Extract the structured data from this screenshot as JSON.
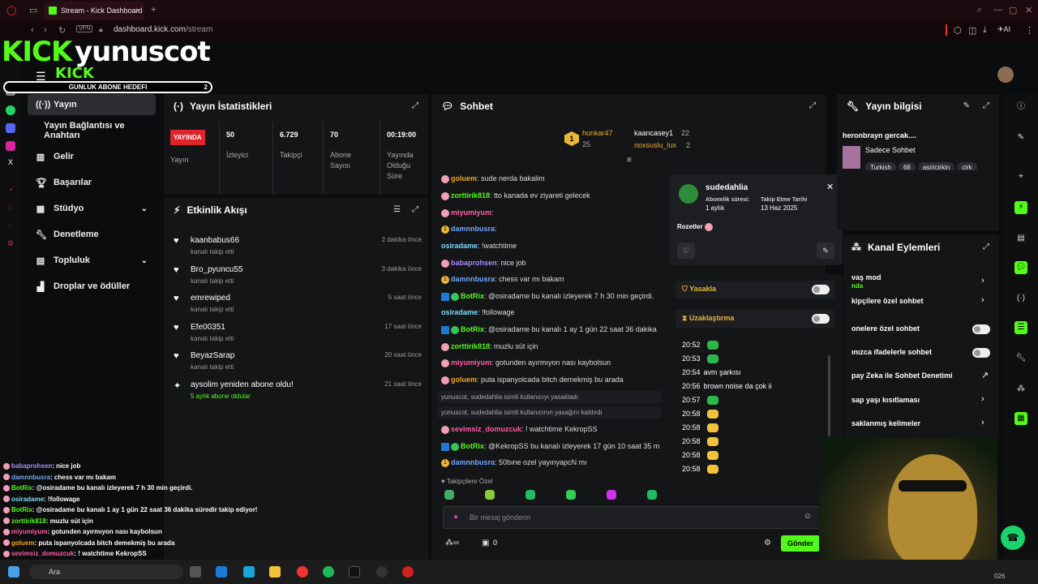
{
  "browser": {
    "tab_title": "Stream - Kick Dashboard",
    "url_domain": "dashboard.kick.com",
    "url_path": "/stream",
    "vpn": "VPN",
    "ai_label": "AI"
  },
  "overlay": {
    "logo_kick": "KICK",
    "channel_name": "yunuscot",
    "logo_small": "KICK",
    "sub_goal_label": "GUNLUK ABONE HEDEFI",
    "sub_goal_count": "2"
  },
  "sidebar": {
    "items": [
      {
        "label": "Yayın",
        "icon": "broadcast-icon"
      },
      {
        "label": "Yayın Bağlantısı ve Anahtarı",
        "icon": ""
      },
      {
        "label": "Gelir",
        "icon": "chart-icon"
      },
      {
        "label": "Başarılar",
        "icon": "trophy-icon"
      },
      {
        "label": "Stüdyo",
        "icon": "studio-icon"
      },
      {
        "label": "Denetleme",
        "icon": "wrench-icon"
      },
      {
        "label": "Topluluk",
        "icon": "community-icon"
      },
      {
        "label": "Droplar ve ödüller",
        "icon": "drops-icon"
      }
    ]
  },
  "stats": {
    "title": "Yayın İstatistikleri",
    "live_badge": "YAYINDA",
    "cells": [
      {
        "value": "",
        "label": "Yayın"
      },
      {
        "value": "50",
        "label": "İzleyici"
      },
      {
        "value": "6.729",
        "label": "Takipçi"
      },
      {
        "value": "70",
        "label": "Abone Sayısı"
      },
      {
        "value": "00:19:00",
        "label": "Yayında Olduğu Süre"
      }
    ]
  },
  "activity": {
    "title": "Etkinlik Akışı",
    "events": [
      {
        "name": "kaanbabus66",
        "sub": "kanalı takip etti",
        "time": "2 dakika önce"
      },
      {
        "name": "Bro_pyuncu55",
        "sub": "kanalı takip etti",
        "time": "3 dakika önce"
      },
      {
        "name": "emrewiped",
        "sub": "kanalı takip etti",
        "time": "5 saat önce"
      },
      {
        "name": "Efe00351",
        "sub": "kanalı takip etti",
        "time": "17 saat önce"
      },
      {
        "name": "BeyazSarap",
        "sub": "kanalı takip etti",
        "time": "20 saat önce"
      },
      {
        "name": "aysolim yeniden abone oldu!",
        "sub": "5 aylık abone oldular",
        "time": "21 saat önce"
      }
    ]
  },
  "chat": {
    "title": "Sohbet",
    "top_gifters": [
      {
        "name": "hunkar47",
        "count": "25"
      },
      {
        "name": "kaancasey1",
        "count": "22"
      },
      {
        "name": "noxsuslu_lux",
        "count": "2"
      }
    ],
    "rank_badge": "1",
    "messages": [
      {
        "user": "goluem",
        "text": ": sude nerda bakalim",
        "color": "#f5a623",
        "badge": "pig"
      },
      {
        "user": "zorttirik818",
        "text": ": tto kanada ev ziyareti gelecek",
        "color": "#53fc18",
        "badge": "pig"
      },
      {
        "user": "miyumiyum",
        "text": ":",
        "color": "#ff5ca8",
        "badge": "pig"
      },
      {
        "user": "damnnbusra",
        "text": ":",
        "color": "#6fa8ff",
        "badge": "gold"
      },
      {
        "user": "osiradame",
        "text": ": !watchtime",
        "color": "#7bdcff",
        "badge": ""
      },
      {
        "user": "babaprohsen",
        "text": ": nice job",
        "color": "#a98cff",
        "badge": "pig"
      },
      {
        "user": "damnnbusra",
        "text": ": chess var mı bakam",
        "color": "#6fa8ff",
        "badge": "gold"
      },
      {
        "user": "osiradame",
        "text": ": !followage",
        "color": "#7bdcff",
        "badge": ""
      },
      {
        "user": "BotRix",
        "text": ": @osiradame bu kanalı izleyerek 7 h 30 min geçirdi.",
        "color": "#53fc18",
        "badge": "bot"
      },
      {
        "user": "BotRix",
        "text": ": @osiradame bu kanalı 1 ay 1 gün 22 saat 36 dakika",
        "color": "#53fc18",
        "badge": "bot"
      },
      {
        "user": "zorttirik818",
        "text": ": muzlu süt için",
        "color": "#53fc18",
        "badge": "pig"
      },
      {
        "user": "miyumiyum",
        "text": ": gotunden ayırmıyon nası kaybolsun",
        "color": "#ff5ca8",
        "badge": "pig"
      },
      {
        "user": "goluem",
        "text": ": puta ispanyolcada bitch demekmiş bu arada",
        "color": "#f5a623",
        "badge": "pig"
      }
    ],
    "system_1": "yunuscot, sudedahlia isimli kullanıcıyı yasakladı",
    "system_2": "yunuscot, sudedahlia isimli kullanıcının yasağını kaldırdı",
    "messages_2": [
      {
        "user": "sevimsiz_domuzcuk",
        "text": ": ! watchtime KekropSS",
        "color": "#ff5ca8",
        "badge": "pig"
      },
      {
        "user": "BotRix",
        "text": ": @KekropSS bu kanalı izleyerek 17 gün 10 saat 35 m",
        "color": "#53fc18",
        "badge": "bot"
      },
      {
        "user": "damnnbusra",
        "text": ": 50bıne ozel yayınyapcN mı",
        "color": "#6fa8ff",
        "badge": "gold"
      }
    ],
    "followers_only": "Takipçilere Özel",
    "input_placeholder": "Bir mesaj gönderin",
    "points": "0",
    "send": "Gönder"
  },
  "usercard": {
    "username": "sudedahlia",
    "sub_label": "Abonelik süresi:",
    "sub_value": "1 aylık",
    "follow_label": "Takip Etme Tarihi",
    "follow_value": "13 Haz 2025",
    "badges_label": "Rozetler"
  },
  "moderation": {
    "ban": "Yasakla",
    "timeout": "Uzaklaştırma",
    "log": [
      {
        "time": "20:52",
        "text": ""
      },
      {
        "time": "20:53",
        "text": ""
      },
      {
        "time": "20:54",
        "text": "avm şarkısı"
      },
      {
        "time": "20:56",
        "text": "brown noise da çok ii"
      },
      {
        "time": "20:57",
        "text": ""
      },
      {
        "time": "20:58",
        "text": ""
      },
      {
        "time": "20:58",
        "text": ""
      },
      {
        "time": "20:58",
        "text": ""
      },
      {
        "time": "20:58",
        "text": ""
      },
      {
        "time": "20:58",
        "text": ""
      }
    ]
  },
  "stream_info": {
    "title": "Yayın bilgisi",
    "stream_title": "heronbrayn gercak....",
    "category": "Sadece Sohbet",
    "tags": [
      "Turkish",
      "68",
      "asiricirkin",
      "cirk"
    ]
  },
  "channel_actions": {
    "title": "Kanal Eylemleri",
    "items": [
      {
        "label": "vaş mod",
        "sub": "nda",
        "control": "chevron"
      },
      {
        "label": "kipçilere özel sohbet",
        "sub": "",
        "control": "chevron"
      },
      {
        "label": "onelere özel sohbet",
        "sub": "",
        "control": "toggle"
      },
      {
        "label": "ınızca ifadelerle sohbet",
        "sub": "",
        "control": "toggle"
      },
      {
        "label": "pay Zeka ile Sohbet Denetimi",
        "sub": "",
        "control": "external"
      },
      {
        "label": "sap yaşı kısıtlaması",
        "sub": "",
        "control": "chevron"
      },
      {
        "label": "saklanmış kelimeler",
        "sub": "",
        "control": "chevron"
      }
    ]
  },
  "overlay_chat": [
    {
      "user": "babaprohsen",
      "text": ": nice job",
      "color": "#a98cff"
    },
    {
      "user": "damnnbusra",
      "text": ": chess var mı bakam",
      "color": "#6fa8ff"
    },
    {
      "user": "BotRix",
      "text": ": @osiradame bu kanalı izleyerek 7 h 30 min geçirdi.",
      "color": "#53fc18"
    },
    {
      "user": "osiradame",
      "text": ": !followage",
      "color": "#7bdcff"
    },
    {
      "user": "BotRix",
      "text": ": @osiradame bu kanalı 1 ay 1 gün 22 saat 36 dakika süredir takip ediyor!",
      "color": "#53fc18"
    },
    {
      "user": "zorttirik818",
      "text": ": muzlu süt için",
      "color": "#53fc18"
    },
    {
      "user": "miyumiyum",
      "text": ": gotunden ayırmıyon nası kaybolsun",
      "color": "#ff5ca8"
    },
    {
      "user": "goluem",
      "text": ": puta ispanyolcada bitch demekmiş bu arada",
      "color": "#f5a623"
    },
    {
      "user": "sevimsiz_domuzcuk",
      "text": ": ! watchtime KekropSS",
      "color": "#ff5ca8"
    }
  ],
  "taskbar": {
    "search": "Ara",
    "year": "026"
  },
  "colors": {
    "kick_green": "#53fc18",
    "live_red": "#e0242b",
    "panel_bg": "#141517"
  }
}
